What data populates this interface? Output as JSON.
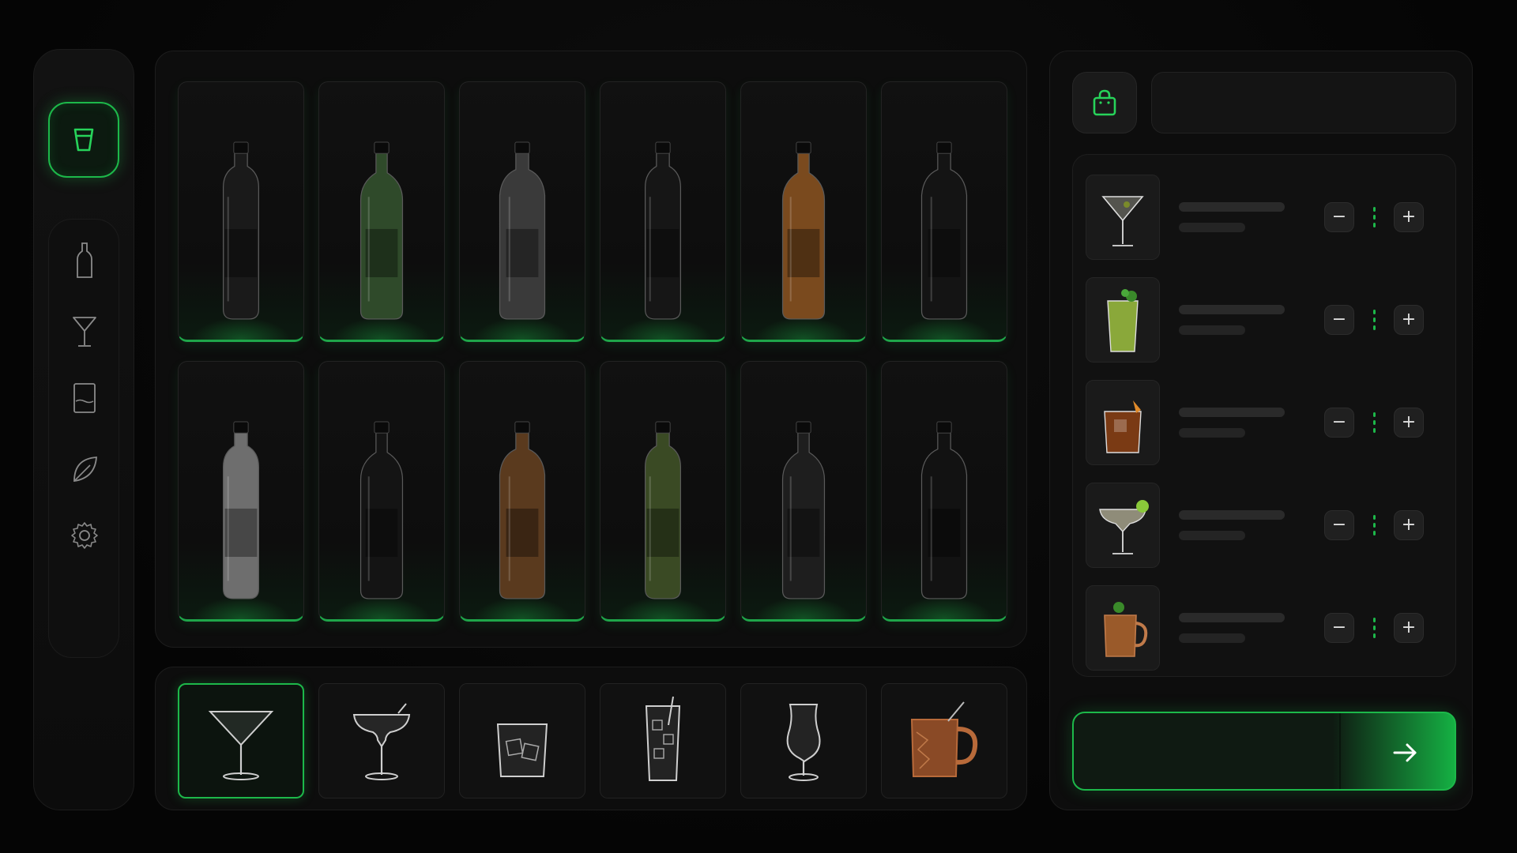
{
  "sidebar": {
    "active_item": "drinks-icon",
    "items": [
      "bottle-icon",
      "martini-glass-icon",
      "tumbler-icon",
      "leaf-icon",
      "settings-icon"
    ]
  },
  "products": [
    {
      "name": "dark-bottle-1",
      "color": "#1a1a1a"
    },
    {
      "name": "green-fluted-bottle",
      "color": "#2f4a2a"
    },
    {
      "name": "clear-bottle-emblem",
      "color": "#3a3a3a"
    },
    {
      "name": "black-bottle",
      "color": "#161616"
    },
    {
      "name": "amber-bottle",
      "color": "#7a4a1e"
    },
    {
      "name": "textured-black-bottle",
      "color": "#141414"
    },
    {
      "name": "clear-ribbed-bottle",
      "color": "#6e6e6e"
    },
    {
      "name": "black-round-bottle",
      "color": "#141414"
    },
    {
      "name": "brown-labeled-bottle",
      "color": "#5a3a1e"
    },
    {
      "name": "olive-bottle",
      "color": "#3a4a24"
    },
    {
      "name": "smoke-bottle",
      "color": "#1e1e1e"
    },
    {
      "name": "patterned-black-bottle",
      "color": "#121212"
    }
  ],
  "glassware": [
    {
      "name": "martini-glass",
      "selected": true
    },
    {
      "name": "margarita-glass",
      "selected": false
    },
    {
      "name": "rocks-glass",
      "selected": false
    },
    {
      "name": "highball-glass",
      "selected": false
    },
    {
      "name": "hurricane-glass",
      "selected": false
    },
    {
      "name": "copper-mug",
      "selected": false
    }
  ],
  "search": {
    "value": "",
    "placeholder": ""
  },
  "order": [
    {
      "thumb": "martini",
      "name": "",
      "sub": ""
    },
    {
      "thumb": "mojito",
      "name": "",
      "sub": ""
    },
    {
      "thumb": "old-fashioned",
      "name": "",
      "sub": ""
    },
    {
      "thumb": "margarita",
      "name": "",
      "sub": ""
    },
    {
      "thumb": "moscow-mule",
      "name": "",
      "sub": ""
    }
  ],
  "qty": {
    "minus": "−",
    "plus": "+"
  },
  "checkout": {
    "label": "",
    "accent": "#1db84a"
  }
}
